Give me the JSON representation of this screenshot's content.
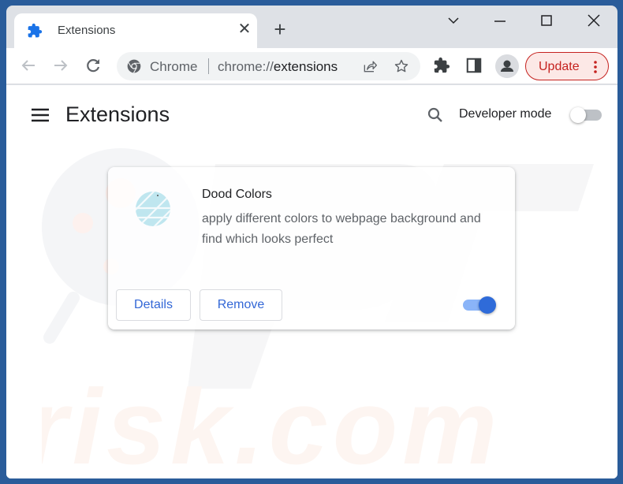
{
  "browser": {
    "tab": {
      "title": "Extensions",
      "icon": "puzzle-icon",
      "close_glyph": "✕"
    },
    "new_tab_glyph": "+",
    "window_controls": [
      "tab-search",
      "minimize",
      "maximize",
      "close"
    ],
    "omnibox": {
      "site_chip": "Chrome",
      "url_scheme": "chrome://",
      "url_host": "extensions"
    },
    "update_button": {
      "label": "Update"
    }
  },
  "page": {
    "title": "Extensions",
    "developer_mode": {
      "label": "Developer mode",
      "enabled": false
    }
  },
  "extensions": [
    {
      "name": "Dood Colors",
      "description": "apply different colors to webpage background and find which looks perfect",
      "enabled": true,
      "details_label": "Details",
      "remove_label": "Remove"
    }
  ],
  "watermark": {
    "text": "risk.com"
  },
  "colors": {
    "accent": "#1a73e8",
    "update_red": "#c5221f",
    "toggle_on": "#2f6bd9",
    "toggle_track_on": "#8ab4f8",
    "frame_bg": "#2a5c9a"
  }
}
